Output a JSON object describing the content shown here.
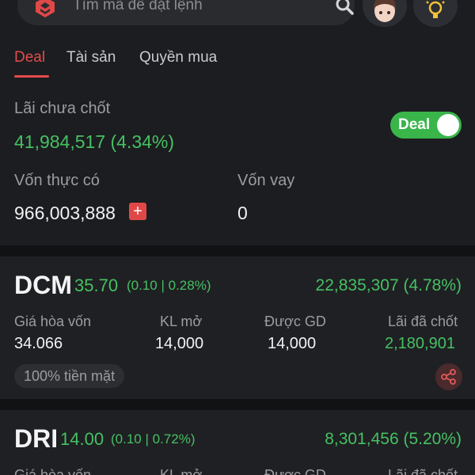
{
  "search": {
    "placeholder": "Tìm mã để đặt lệnh"
  },
  "tabs": [
    {
      "label": "Deal",
      "active": true
    },
    {
      "label": "Tài sản",
      "active": false
    },
    {
      "label": "Quyền mua",
      "active": false
    }
  ],
  "summary": {
    "unrealized_label": "Lãi chưa chốt",
    "unrealized_value": "41,984,517 (4.34%)",
    "deal_toggle_label": "Deal",
    "deal_toggle_on": true,
    "equity_label": "Vốn thực có",
    "equity_value": "966,003,888",
    "loan_label": "Vốn vay",
    "loan_value": "0"
  },
  "columns": {
    "breakeven": "Giá hòa vốn",
    "open_qty": "KL mở",
    "tradable": "Được GD",
    "realized": "Lãi đã chốt"
  },
  "holdings": [
    {
      "symbol": "DCM",
      "price": "35.70",
      "change": "(0.10 | 0.28%)",
      "pnl": "22,835,307 (4.78%)",
      "breakeven": "34.066",
      "open_qty": "14,000",
      "tradable": "14,000",
      "realized": "2,180,901",
      "badge": "100% tiền mặt"
    },
    {
      "symbol": "DRI",
      "price": "14.00",
      "change": "(0.10 | 0.72%)",
      "pnl": "8,301,456 (5.20%)"
    }
  ],
  "colors": {
    "accent_red": "#e34b4b",
    "positive_green": "#46c063",
    "background": "#1c1d20"
  },
  "icons": [
    "app-logo-icon",
    "search-icon",
    "avatar",
    "lightbulb-icon",
    "plus-icon",
    "share-icon"
  ]
}
